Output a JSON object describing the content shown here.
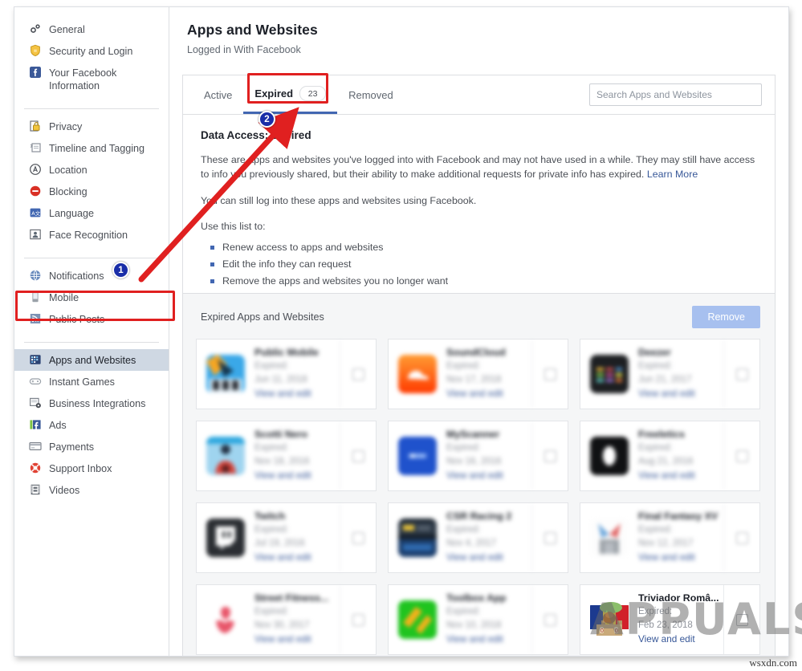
{
  "sidebar": {
    "groups": [
      {
        "items": [
          {
            "label": "General",
            "icon": "gears-icon"
          },
          {
            "label": "Security and Login",
            "icon": "shield-icon"
          },
          {
            "label": "Your Facebook Information",
            "icon": "facebook-icon"
          }
        ]
      },
      {
        "items": [
          {
            "label": "Privacy",
            "icon": "lock-icon"
          },
          {
            "label": "Timeline and Tagging",
            "icon": "timeline-icon"
          },
          {
            "label": "Location",
            "icon": "location-icon"
          },
          {
            "label": "Blocking",
            "icon": "block-icon"
          },
          {
            "label": "Language",
            "icon": "language-icon"
          },
          {
            "label": "Face Recognition",
            "icon": "face-icon"
          }
        ]
      },
      {
        "items": [
          {
            "label": "Notifications",
            "icon": "globe-icon"
          },
          {
            "label": "Mobile",
            "icon": "mobile-icon"
          },
          {
            "label": "Public Posts",
            "icon": "rss-icon"
          }
        ]
      },
      {
        "items": [
          {
            "label": "Apps and Websites",
            "icon": "apps-icon",
            "selected": true
          },
          {
            "label": "Instant Games",
            "icon": "gamepad-icon"
          },
          {
            "label": "Business Integrations",
            "icon": "business-icon"
          },
          {
            "label": "Ads",
            "icon": "ads-icon"
          },
          {
            "label": "Payments",
            "icon": "card-icon"
          },
          {
            "label": "Support Inbox",
            "icon": "lifebuoy-icon"
          },
          {
            "label": "Videos",
            "icon": "film-icon"
          }
        ]
      }
    ]
  },
  "header": {
    "title": "Apps and Websites",
    "subtitle": "Logged in With Facebook"
  },
  "tabs": [
    {
      "label": "Active",
      "count": null,
      "active": false
    },
    {
      "label": "Expired",
      "count": "23",
      "active": true
    },
    {
      "label": "Removed",
      "count": null,
      "active": false
    }
  ],
  "search": {
    "placeholder": "Search Apps and Websites",
    "value": ""
  },
  "section": {
    "title": "Data Access: Expired",
    "paragraph1": "These are apps and websites you've logged into with Facebook and may not have used in a while. They may still have access to info you previously shared, but their ability to make additional requests for private info has expired.",
    "learn_more": "Learn More",
    "paragraph2": "You can still log into these apps and websites using Facebook.",
    "use_label": "Use this list to:",
    "bullets": [
      "Renew access to apps and websites",
      "Edit the info they can request",
      "Remove the apps and websites you no longer want"
    ]
  },
  "apps_panel": {
    "title": "Expired Apps and Websites",
    "remove_label": "Remove",
    "expired_prefix": "Expired:",
    "view_edit_label": "View and edit",
    "cards": [
      {
        "name": "Public Mobile",
        "expired_label": "Expired:",
        "expired_date": "Jun 11, 2018",
        "link": "View and edit",
        "icon": "app-icon-public-mobile",
        "blurred": true
      },
      {
        "name": "SoundCloud",
        "expired_label": "Expired:",
        "expired_date": "Nov 17, 2018",
        "link": "View and edit",
        "icon": "app-icon-soundcloud",
        "blurred": true
      },
      {
        "name": "Deezer",
        "expired_label": "Expired:",
        "expired_date": "Jun 21, 2017",
        "link": "View and edit",
        "icon": "app-icon-deezer",
        "blurred": true
      },
      {
        "name": "Scotti Nero",
        "expired_label": "Expired:",
        "expired_date": "Nov 18, 2016",
        "link": "View and edit",
        "icon": "app-icon-scotti",
        "blurred": true
      },
      {
        "name": "MyScanner",
        "expired_label": "Expired:",
        "expired_date": "Nov 16, 2016",
        "link": "View and edit",
        "icon": "app-icon-myscanner",
        "blurred": true
      },
      {
        "name": "Freeletics",
        "expired_label": "Expired:",
        "expired_date": "Aug 21, 2016",
        "link": "View and edit",
        "icon": "app-icon-freeletics",
        "blurred": true
      },
      {
        "name": "Twitch",
        "expired_label": "Expired:",
        "expired_date": "Jul 19, 2016",
        "link": "View and edit",
        "icon": "app-icon-twitch",
        "blurred": true
      },
      {
        "name": "CSR Racing 2",
        "expired_label": "Expired:",
        "expired_date": "Nov 4, 2017",
        "link": "View and edit",
        "icon": "app-icon-csr",
        "blurred": true
      },
      {
        "name": "Final Fantasy XV",
        "expired_label": "Expired:",
        "expired_date": "Nov 12, 2017",
        "link": "View and edit",
        "icon": "app-icon-ffxv",
        "blurred": true
      },
      {
        "name": "Street Fitness...",
        "expired_label": "Expired:",
        "expired_date": "Nov 30, 2017",
        "link": "View and edit",
        "icon": "app-icon-street",
        "blurred": true
      },
      {
        "name": "Toolbox App",
        "expired_label": "Expired:",
        "expired_date": "Nov 10, 2018",
        "link": "View and edit",
        "icon": "app-icon-toolbox",
        "blurred": true
      },
      {
        "name": "Triviador Româ...",
        "expired_label": "Expired:",
        "expired_date": "Feb 23, 2018",
        "link": "View and edit",
        "icon": "app-icon-triviador",
        "blurred": false
      }
    ]
  },
  "annotations": {
    "badge1": "1",
    "badge2": "2",
    "arrow_color": "#e02020",
    "box_color": "#e02020",
    "badge_color": "#1a2ea8"
  },
  "watermarks": {
    "main": "APPUALS",
    "corner": "wsxdn.com"
  },
  "colors": {
    "fb_blue": "#4267b2",
    "link": "#385898",
    "text": "#1d2129",
    "muted": "#606770",
    "panel_bg": "#f5f6f7"
  }
}
